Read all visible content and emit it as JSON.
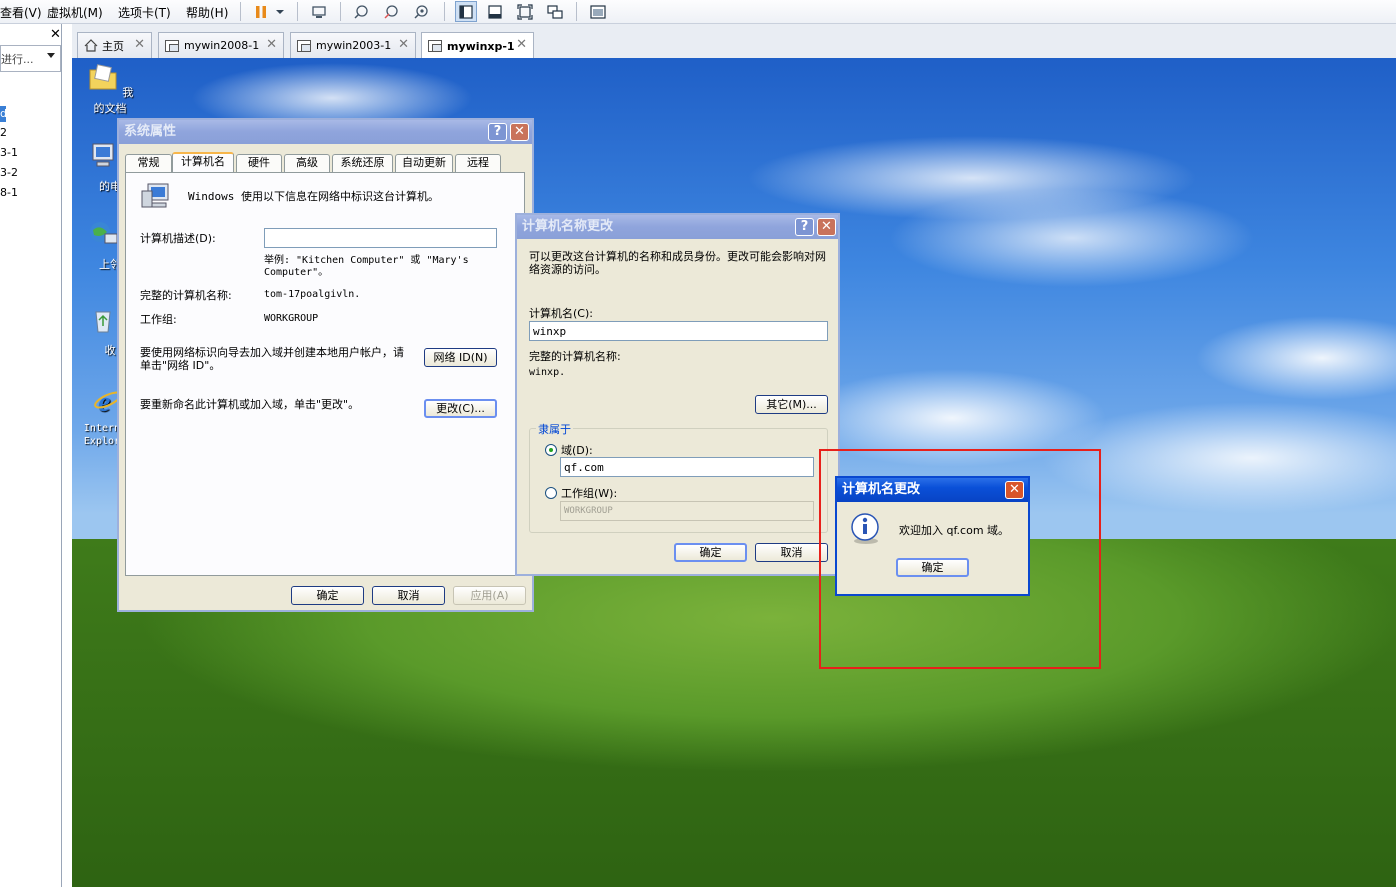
{
  "menubar": {
    "items": [
      "查看(V)",
      "虚拟机(M)",
      "选项卡(T)",
      "帮助(H)"
    ]
  },
  "library": {
    "search_placeholder": "进行...",
    "items": [
      "d",
      "2",
      "3-1",
      "3-2",
      "8-1"
    ]
  },
  "tabs": [
    {
      "label": "主页",
      "icon": "home-icon"
    },
    {
      "label": "mywin2008-1",
      "icon": "vm-icon"
    },
    {
      "label": "mywin2003-1",
      "icon": "vm-icon"
    },
    {
      "label": "mywinxp-1",
      "icon": "vm-icon"
    }
  ],
  "desktop": {
    "icons": [
      {
        "label": "我的文档",
        "icon": "my-documents-icon"
      },
      {
        "label": "我的电",
        "icon": "my-computer-icon"
      },
      {
        "label": "网上邻",
        "icon": "network-places-icon"
      },
      {
        "label": "回收",
        "icon": "recycle-bin-icon"
      },
      {
        "label": "Internet Explorer",
        "icon": "internet-explorer-icon"
      }
    ]
  },
  "sys_props": {
    "title": "系统属性",
    "tabs": [
      "常规",
      "计算机名",
      "硬件",
      "高级",
      "系统还原",
      "自动更新",
      "远程"
    ],
    "intro": "Windows 使用以下信息在网络中标识这台计算机。",
    "desc_label": "计算机描述(D):",
    "desc_value": "",
    "example": "举例: \"Kitchen Computer\" 或 \"Mary's Computer\"。",
    "fullname_label": "完整的计算机名称:",
    "fullname_value": "tom-17poalgivln.",
    "workgroup_label": "工作组:",
    "workgroup_value": "WORKGROUP",
    "network_text": "要使用网络标识向导去加入域并创建本地用户帐户，请单击\"网络 ID\"。",
    "network_btn": "网络 ID(N)",
    "rename_text": "要重新命名此计算机或加入域，单击\"更改\"。",
    "change_btn": "更改(C)...",
    "ok": "确定",
    "cancel": "取消",
    "apply": "应用(A)"
  },
  "name_change": {
    "title": "计算机名称更改",
    "intro": "可以更改这台计算机的名称和成员身份。更改可能会影响对网络资源的访问。",
    "name_label": "计算机名(C):",
    "name_value": "winxp",
    "fullname_label": "完整的计算机名称:",
    "fullname_value": "winxp.",
    "other_btn": "其它(M)...",
    "member_of": "隶属于",
    "domain_label": "域(D):",
    "domain_value": "qf.com",
    "workgroup_label": "工作组(W):",
    "workgroup_value": "WORKGROUP",
    "ok": "确定",
    "cancel": "取消"
  },
  "welcome": {
    "title": "计算机名更改",
    "message": "欢迎加入 qf.com 域。",
    "ok": "确定"
  },
  "colors": {
    "highlight": "#e8201a",
    "xp_title_active": "#0a50d8",
    "xp_face": "#ece9d8"
  }
}
